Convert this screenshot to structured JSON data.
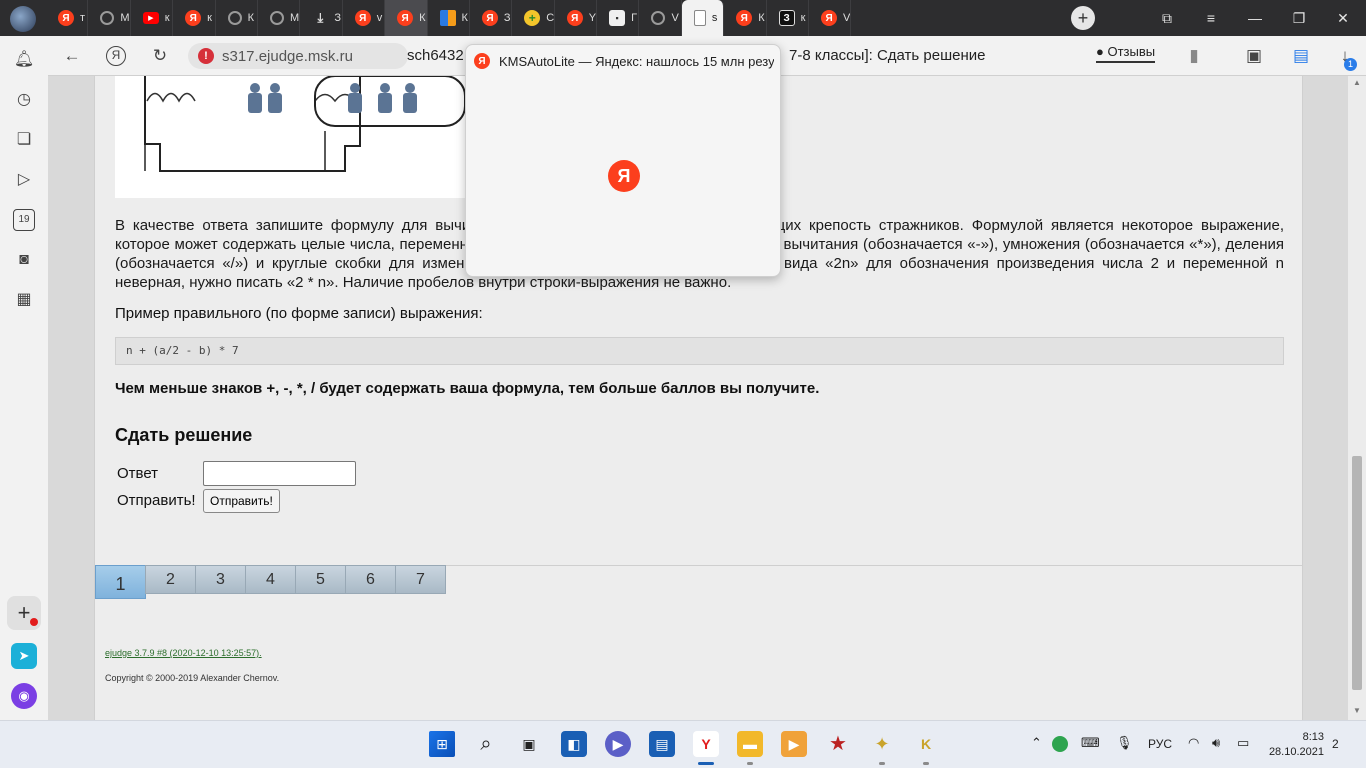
{
  "tabs": [
    {
      "icon": "yandex-icon",
      "title": "т"
    },
    {
      "icon": "gear-icon",
      "title": "М"
    },
    {
      "icon": "youtube-icon",
      "title": "к"
    },
    {
      "icon": "yandex-icon",
      "title": "к"
    },
    {
      "icon": "gear-icon",
      "title": "К"
    },
    {
      "icon": "gear-icon",
      "title": "М"
    },
    {
      "icon": "download-icon",
      "title": "З"
    },
    {
      "icon": "yandex-icon",
      "title": "v"
    },
    {
      "icon": "yandex-icon",
      "title": "К"
    },
    {
      "icon": "app-icon",
      "title": "К"
    },
    {
      "icon": "yandex-icon",
      "title": "З"
    },
    {
      "icon": "plus-circle-icon",
      "title": "С"
    },
    {
      "icon": "yandex-icon",
      "title": "Y"
    },
    {
      "icon": "chat-icon",
      "title": "Г"
    },
    {
      "icon": "gear-icon",
      "title": "V"
    },
    {
      "icon": "document-icon",
      "title": "s"
    },
    {
      "icon": "yandex-icon",
      "title": "К"
    },
    {
      "icon": "zen-icon",
      "title": "к"
    },
    {
      "icon": "yandex-icon",
      "title": "V"
    }
  ],
  "active_tab_index": 15,
  "hover_tab_index": 8,
  "address_bar": {
    "url": "s317.ejudge.msk.ru",
    "title_left": "sch6432",
    "title_right": "7-8 классы]: Сдать решение",
    "reviews_label": "Отзывы",
    "download_count": "1"
  },
  "tab_preview": {
    "title": "KMSAutoLite — Яндекс: нашлось 15 млн резу…",
    "logo": "Я"
  },
  "problem": {
    "paragraph": "В качестве ответа запишите формулу для вычисления количества охранников, оберегающих крепость стражников. Формулой является некоторое выражение, которое может содержать целые числа, переменные, операции сложения (обозначается «+»), вычитания (обозначается «-»), умножения (обозначается «*»), деления (обозначается «/») и круглые скобки для изменения порядка действий. Например, запись вида «2n» для обозначения произведения числа 2 и переменной n неверная, нужно писать «2 * n». Наличие пробелов внутри строки-выражения не важно.",
    "example_label": "Пример правильного (по форме записи) выражения:",
    "example_code": "n + (a/2 - b) * 7",
    "bold_note": "Чем меньше знаков +, -, *, / будет содержать ваша формула, тем больше баллов вы получите."
  },
  "submit": {
    "heading": "Сдать решение",
    "answer_label": "Ответ",
    "answer_value": "",
    "send_label": "Отправить!",
    "send_button": "Отправить!"
  },
  "pager": {
    "pages": [
      "1",
      "2",
      "3",
      "4",
      "5",
      "6",
      "7"
    ],
    "current": "1"
  },
  "footer": {
    "version": "ejudge 3.7.9 #8 (2020-12-10 13:25:57).",
    "copyright": "Copyright © 2000-2019 Alexander Chernov."
  },
  "taskbar": {
    "language": "РУС",
    "time": "8:13",
    "date": "28.10.2021",
    "notifications": "2"
  },
  "colors": {
    "accent": "#fc3f1d",
    "pager_active": "#7fb2dc",
    "link": "#2c6e2c"
  }
}
